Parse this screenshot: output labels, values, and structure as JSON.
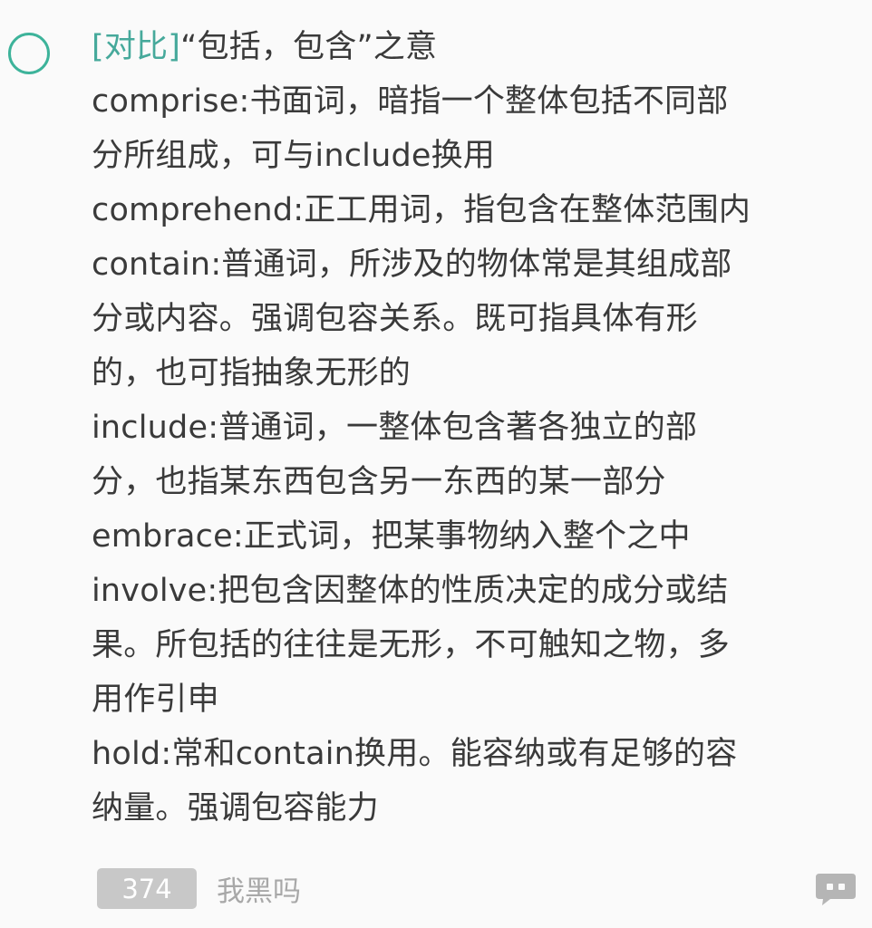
{
  "note": {
    "tag": "[对比]",
    "title": "“包括，包含”之意",
    "lines": [
      "comprise:书面词，暗指一个整体包括不同部",
      "分所组成，可与include换用",
      "comprehend:正工用词，指包含在整体范围内",
      "contain:普通词，所涉及的物体常是其组成部",
      "分或内容。强调包容关系。既可指具体有形",
      "的，也可指抽象无形的",
      "include:普通词，一整体包含著各独立的部",
      "分，也指某东西包含另一东西的某一部分",
      "embrace:正式词，把某事物纳入整个之中",
      "involve:把包含因整体的性质决定的成分或结",
      "果。所包括的往往是无形，不可触知之物，多",
      "用作引申",
      "hold:常和contain换用。能容纳或有足够的容",
      "纳量。强调包容能力"
    ]
  },
  "footer": {
    "count": "374",
    "author": "我黑吗"
  },
  "colors": {
    "accent": "#3db39a",
    "tag": "#46a99b",
    "text": "#3a3a3a",
    "badge_bg": "#c8c8c8",
    "muted": "#a8a8a8",
    "icon": "#b5b5b5"
  },
  "icons": {
    "checkbox": "circle-checkbox-icon",
    "comment": "comment-icon"
  }
}
